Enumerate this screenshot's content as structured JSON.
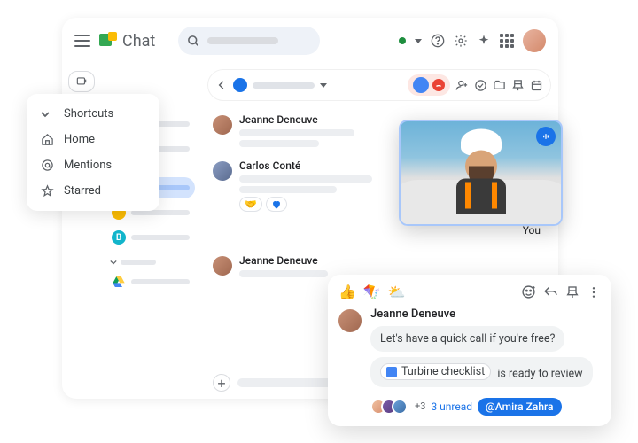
{
  "header": {
    "app_name": "Chat"
  },
  "shortcuts": {
    "title": "Shortcuts",
    "items": [
      "Home",
      "Mentions",
      "Starred"
    ]
  },
  "sidebar": {
    "b_label": "B"
  },
  "thread": {
    "messages": [
      {
        "sender": "Jeanne Deneuve"
      },
      {
        "sender": "Carlos Conté"
      },
      {
        "sender": "Jeanne Deneuve"
      }
    ],
    "you_label": "You"
  },
  "thread_card": {
    "sender": "Jeanne Deneuve",
    "msg1": "Let's have a quick call if you're free?",
    "doc_name": "Turbine checklist",
    "doc_suffix": " is ready to review",
    "extra_count": "+3",
    "unread_text": "3 unread",
    "mention": "@Amira Zahra"
  }
}
